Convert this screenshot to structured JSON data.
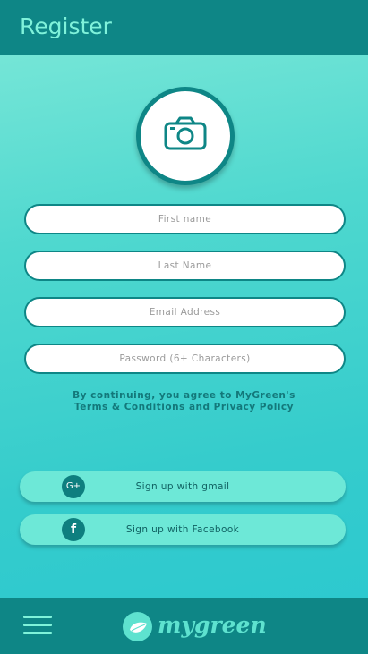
{
  "header": {
    "title": "Register"
  },
  "avatar": {
    "icon": "camera-icon"
  },
  "form": {
    "first_name_placeholder": "First name",
    "last_name_placeholder": "Last Name",
    "email_placeholder": "Email Address",
    "password_placeholder": "Password (6+ Characters)"
  },
  "terms": {
    "line1": "By continuing, you agree to MyGreen's",
    "line2": "Terms & Conditions and Privacy Policy"
  },
  "social": {
    "gmail_label": "Sign up with gmail",
    "gmail_icon_text": "G+",
    "facebook_label": "Sign up with Facebook",
    "facebook_icon_text": "f"
  },
  "footer": {
    "logo_text": "mygreen",
    "menu_icon": "hamburger-menu-icon"
  },
  "colors": {
    "primary": "#0e8686",
    "accent": "#7ff2da",
    "button_bg": "#6de8d7",
    "background_top": "#7fe9d9",
    "background_bottom": "#2ac8d0"
  }
}
